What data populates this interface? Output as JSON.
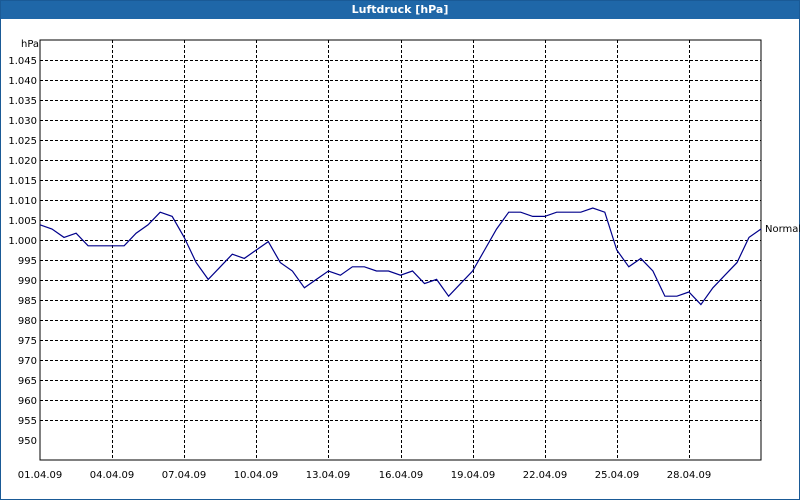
{
  "window": {
    "title": "Luftdruck [hPa]"
  },
  "colors": {
    "titlebar": "#1f67a8",
    "series": "#00008b",
    "grid": "#000000",
    "background": "#ffffff"
  },
  "chart_data": {
    "type": "line",
    "title": "Luftdruck [hPa]",
    "ylabel": "hPa",
    "xlabel": "",
    "ylim": [
      950,
      1050
    ],
    "xlim": [
      "2009-04-01",
      "2009-04-31"
    ],
    "grid": true,
    "y_ticks": [
      "1.045",
      "1.040",
      "1.035",
      "1.030",
      "1.025",
      "1.020",
      "1.015",
      "1.010",
      "1.005",
      "1.000",
      "995",
      "990",
      "985",
      "980",
      "975",
      "970",
      "965",
      "960",
      "955",
      "950"
    ],
    "x_ticks": [
      "01.04.09",
      "04.04.09",
      "07.04.09",
      "10.04.09",
      "13.04.09",
      "16.04.09",
      "19.04.09",
      "22.04.09",
      "25.04.09",
      "28.04.09"
    ],
    "series": [
      {
        "name": "Normal",
        "x": [
          "2009-04-01",
          "2009-04-01 12:00",
          "2009-04-02",
          "2009-04-02 12:00",
          "2009-04-03",
          "2009-04-03 12:00",
          "2009-04-04",
          "2009-04-04 12:00",
          "2009-04-05",
          "2009-04-05 12:00",
          "2009-04-06",
          "2009-04-06 12:00",
          "2009-04-07",
          "2009-04-07 12:00",
          "2009-04-08",
          "2009-04-08 12:00",
          "2009-04-09",
          "2009-04-09 12:00",
          "2009-04-10",
          "2009-04-10 12:00",
          "2009-04-11",
          "2009-04-11 12:00",
          "2009-04-12",
          "2009-04-12 12:00",
          "2009-04-13",
          "2009-04-13 12:00",
          "2009-04-14",
          "2009-04-14 12:00",
          "2009-04-15",
          "2009-04-15 12:00",
          "2009-04-16",
          "2009-04-16 12:00",
          "2009-04-17",
          "2009-04-17 12:00",
          "2009-04-18",
          "2009-04-18 12:00",
          "2009-04-19",
          "2009-04-19 12:00",
          "2009-04-20",
          "2009-04-20 12:00",
          "2009-04-21",
          "2009-04-21 12:00",
          "2009-04-22",
          "2009-04-22 12:00",
          "2009-04-23",
          "2009-04-23 12:00",
          "2009-04-24",
          "2009-04-24 12:00",
          "2009-04-25",
          "2009-04-25 12:00",
          "2009-04-26",
          "2009-04-26 12:00",
          "2009-04-27",
          "2009-04-27 12:00",
          "2009-04-28",
          "2009-04-28 12:00",
          "2009-04-29",
          "2009-04-29 12:00",
          "2009-04-30",
          "2009-04-30 12:00",
          "2009-04-31"
        ],
        "values": [
          1006,
          1005,
          1003,
          1004,
          1001,
          1001,
          1001,
          1001,
          1004,
          1006,
          1009,
          1008,
          1003,
          997,
          993,
          996,
          999,
          998,
          1000,
          1002,
          997,
          995,
          991,
          993,
          995,
          994,
          996,
          996,
          995,
          995,
          994,
          995,
          992,
          993,
          989,
          992,
          995,
          1000,
          1005,
          1009,
          1009,
          1008,
          1008,
          1009,
          1009,
          1009,
          1010,
          1009,
          1000,
          996,
          998,
          995,
          989,
          989,
          990,
          987,
          991,
          994,
          997,
          1003,
          1005
        ]
      }
    ]
  }
}
